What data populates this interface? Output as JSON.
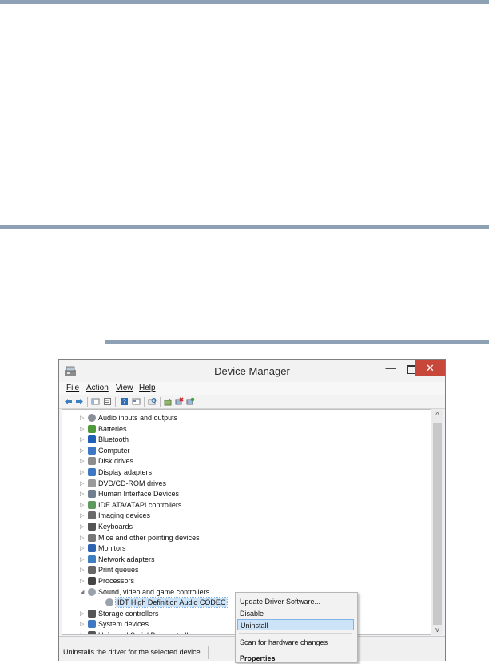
{
  "window": {
    "title": "Device Manager",
    "minimize_glyph": "—",
    "close_glyph": "✕"
  },
  "menubar": {
    "items": [
      "File",
      "Action",
      "View",
      "Help"
    ]
  },
  "toolbar": {
    "icons": [
      "back-arrow-icon",
      "forward-arrow-icon",
      "show-hide-icon",
      "properties-icon",
      "help-icon",
      "view-icon",
      "scan-icon",
      "update-driver-icon",
      "uninstall-icon",
      "enable-icon"
    ]
  },
  "tree": {
    "categories": [
      {
        "label": "Audio inputs and outputs",
        "icon": "speaker-icon",
        "expanded": false
      },
      {
        "label": "Batteries",
        "icon": "battery-icon",
        "expanded": false
      },
      {
        "label": "Bluetooth",
        "icon": "bluetooth-icon",
        "expanded": false
      },
      {
        "label": "Computer",
        "icon": "computer-icon",
        "expanded": false
      },
      {
        "label": "Disk drives",
        "icon": "disk-drive-icon",
        "expanded": false
      },
      {
        "label": "Display adapters",
        "icon": "display-adapter-icon",
        "expanded": false
      },
      {
        "label": "DVD/CD-ROM drives",
        "icon": "dvd-drive-icon",
        "expanded": false
      },
      {
        "label": "Human Interface Devices",
        "icon": "hid-icon",
        "expanded": false
      },
      {
        "label": "IDE ATA/ATAPI controllers",
        "icon": "ide-controller-icon",
        "expanded": false
      },
      {
        "label": "Imaging devices",
        "icon": "camera-icon",
        "expanded": false
      },
      {
        "label": "Keyboards",
        "icon": "keyboard-icon",
        "expanded": false
      },
      {
        "label": "Mice and other pointing devices",
        "icon": "mouse-icon",
        "expanded": false
      },
      {
        "label": "Monitors",
        "icon": "monitor-icon",
        "expanded": false
      },
      {
        "label": "Network adapters",
        "icon": "network-adapter-icon",
        "expanded": false
      },
      {
        "label": "Print queues",
        "icon": "printer-icon",
        "expanded": false
      },
      {
        "label": "Processors",
        "icon": "processor-icon",
        "expanded": false
      },
      {
        "label": "Sound, video and game controllers",
        "icon": "sound-icon",
        "expanded": true
      },
      {
        "label": "IDT High Definition Audio CODEC",
        "icon": "audio-device-icon",
        "child": true,
        "selected": true
      },
      {
        "label": "Storage controllers",
        "icon": "storage-controller-icon",
        "expanded": false
      },
      {
        "label": "System devices",
        "icon": "system-device-icon",
        "expanded": false
      },
      {
        "label": "Universal Serial Bus controllers",
        "icon": "usb-icon",
        "expanded": false
      }
    ]
  },
  "context_menu": {
    "items": [
      {
        "label": "Update Driver Software...",
        "highlighted": false,
        "bold": false
      },
      {
        "label": "Disable",
        "highlighted": false,
        "bold": false
      },
      {
        "label": "Uninstall",
        "highlighted": true,
        "bold": false
      },
      {
        "separator": true
      },
      {
        "label": "Scan for hardware changes",
        "highlighted": false,
        "bold": false
      },
      {
        "separator": true
      },
      {
        "label": "Properties",
        "highlighted": false,
        "bold": true
      }
    ]
  },
  "statusbar": {
    "text": "Uninstalls the driver for the selected device."
  },
  "colors": {
    "rule": "#8da0b4",
    "close_button": "#c7483b",
    "highlight": "#cde3f7",
    "highlight_border": "#7eb4ea"
  }
}
